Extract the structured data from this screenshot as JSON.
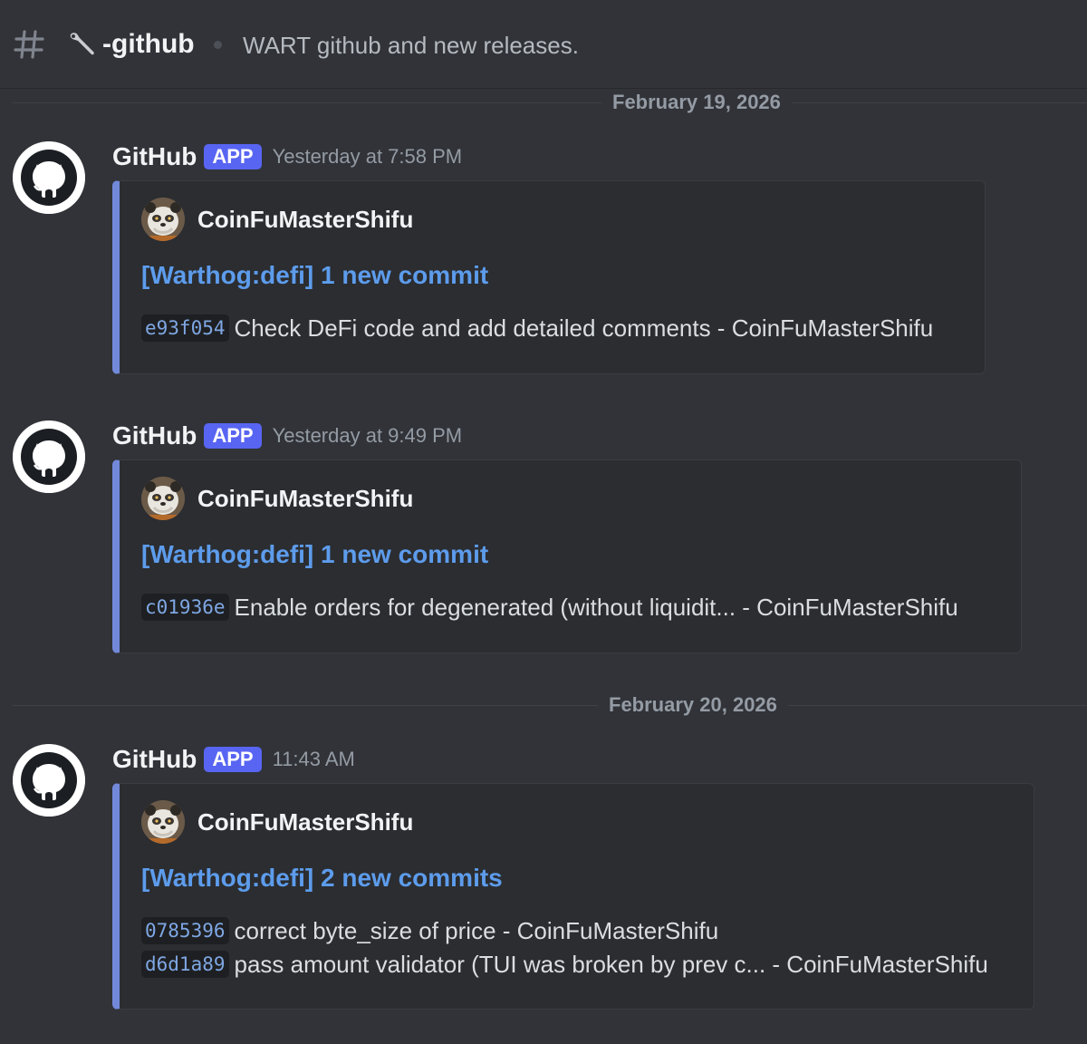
{
  "channel": {
    "name": "-github",
    "topic": "WART github and new releases."
  },
  "dividers": [
    {
      "date": "February 19, 2026"
    },
    {
      "date": "February 20, 2026"
    }
  ],
  "messages": [
    {
      "author": "GitHub",
      "badge": "APP",
      "timestamp": "Yesterday at 7:58 PM",
      "embed": {
        "author": "CoinFuMasterShifu",
        "title": "[Warthog:defi] 1 new commit",
        "commits": [
          {
            "hash": "e93f054",
            "message": "Check DeFi code and add detailed comments - CoinFuMasterShifu"
          }
        ]
      }
    },
    {
      "author": "GitHub",
      "badge": "APP",
      "timestamp": "Yesterday at 9:49 PM",
      "embed": {
        "author": "CoinFuMasterShifu",
        "title": "[Warthog:defi] 1 new commit",
        "commits": [
          {
            "hash": "c01936e",
            "message": "Enable orders for degenerated (without liquidit... - CoinFuMasterShifu"
          }
        ]
      }
    },
    {
      "author": "GitHub",
      "badge": "APP",
      "timestamp": "11:43 AM",
      "embed": {
        "author": "CoinFuMasterShifu",
        "title": "[Warthog:defi] 2 new commits",
        "commits": [
          {
            "hash": "0785396",
            "message": "correct byte_size of price - CoinFuMasterShifu"
          },
          {
            "hash": "d6d1a89",
            "message": "pass amount validator (TUI was broken by prev c... - CoinFuMasterShifu"
          }
        ]
      }
    }
  ],
  "colors": {
    "background": "#313338",
    "embed_background": "#2b2d31",
    "embed_accent": "#7289da",
    "link": "#5d9cec",
    "app_badge": "#5865f2"
  },
  "icons": {
    "channel": "hash-icon",
    "channel_emoji": "wrench-icon",
    "bot_avatar": "github-logo-icon",
    "embed_author_avatar": "panda-avatar-icon"
  }
}
